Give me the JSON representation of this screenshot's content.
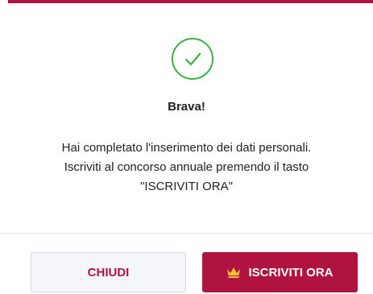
{
  "dialog": {
    "title": "Brava!",
    "message_lines": [
      "Hai completato l'inserimento dei dati personali.",
      "Iscriviti al concorso annuale premendo il tasto",
      "\"ISCRIVITI ORA\""
    ],
    "icon": "check-circle-icon"
  },
  "buttons": {
    "close_label": "CHIUDI",
    "subscribe_label": "ISCRIVITI ORA",
    "subscribe_icon": "crown-icon"
  },
  "colors": {
    "accent": "#b0133f",
    "success": "#3cb043",
    "crown": "#f7c531"
  }
}
